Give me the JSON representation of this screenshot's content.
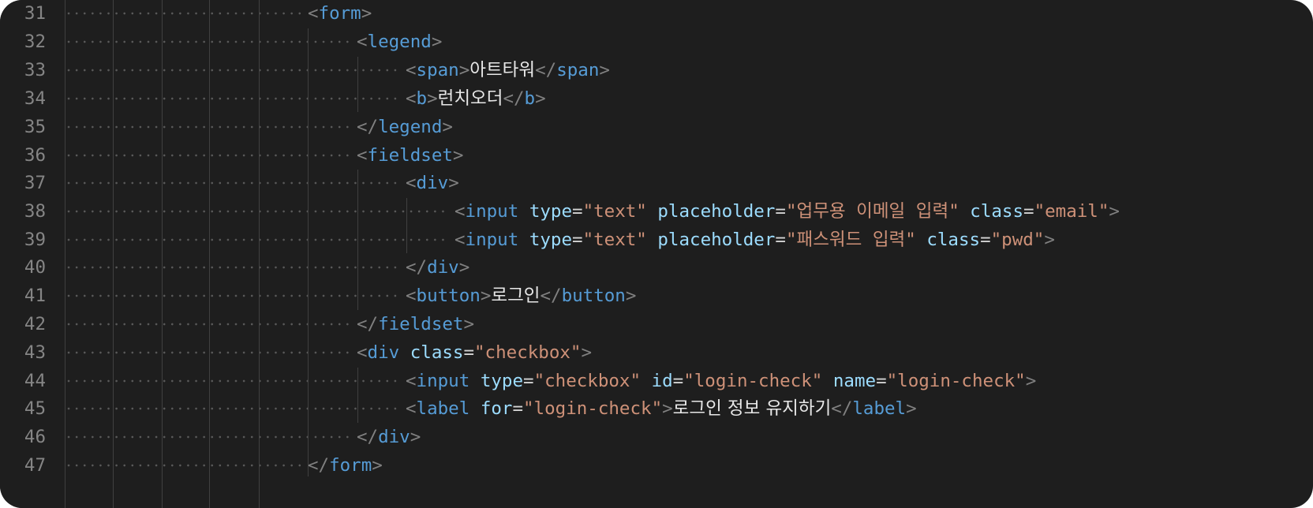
{
  "editor": {
    "line_numbers": [
      "31",
      "32",
      "33",
      "34",
      "35",
      "36",
      "37",
      "38",
      "39",
      "40",
      "41",
      "42",
      "43",
      "44",
      "45",
      "46",
      "47"
    ],
    "code": {
      "l31": {
        "open": "<",
        "tag": "form",
        "close": ">"
      },
      "l32": {
        "open": "<",
        "tag": "legend",
        "close": ">"
      },
      "l33": {
        "open": "<",
        "tag": "span",
        "close": ">",
        "text": "아트타워",
        "end_open": "</",
        "end_tag": "span",
        "end_close": ">"
      },
      "l34": {
        "open": "<",
        "tag": "b",
        "close": ">",
        "text": "런치오더",
        "end_open": "</",
        "end_tag": "b",
        "end_close": ">"
      },
      "l35": {
        "open": "</",
        "tag": "legend",
        "close": ">"
      },
      "l36": {
        "open": "<",
        "tag": "fieldset",
        "close": ">"
      },
      "l37": {
        "open": "<",
        "tag": "div",
        "close": ">"
      },
      "l38": {
        "open": "<",
        "tag": "input",
        "attr1": "type",
        "val1": "\"text\"",
        "attr2": "placeholder",
        "val2": "\"업무용 이메일 입력\"",
        "attr3": "class",
        "val3": "\"email\"",
        "close": ">"
      },
      "l39": {
        "open": "<",
        "tag": "input",
        "attr1": "type",
        "val1": "\"text\"",
        "attr2": "placeholder",
        "val2": "\"패스워드 입력\"",
        "attr3": "class",
        "val3": "\"pwd\"",
        "close": ">"
      },
      "l40": {
        "open": "</",
        "tag": "div",
        "close": ">"
      },
      "l41": {
        "open": "<",
        "tag": "button",
        "close": ">",
        "text": "로그인",
        "end_open": "</",
        "end_tag": "button",
        "end_close": ">"
      },
      "l42": {
        "open": "</",
        "tag": "fieldset",
        "close": ">"
      },
      "l43": {
        "open": "<",
        "tag": "div",
        "attr1": "class",
        "val1": "\"checkbox\"",
        "close": ">"
      },
      "l44": {
        "open": "<",
        "tag": "input",
        "attr1": "type",
        "val1": "\"checkbox\"",
        "attr2": "id",
        "val2": "\"login-check\"",
        "attr3": "name",
        "val3": "\"login-check\"",
        "close": ">"
      },
      "l45": {
        "open": "<",
        "tag": "label",
        "attr1": "for",
        "val1": "\"login-check\"",
        "close": ">",
        "text": "로그인 정보 유지하기",
        "end_open": "</",
        "end_tag": "label",
        "end_close": ">"
      },
      "l46": {
        "open": "</",
        "tag": "div",
        "close": ">"
      },
      "l47": {
        "open": "</",
        "tag": "form",
        "close": ">"
      }
    },
    "eq": "=",
    "colors": {
      "background": "#1e1e1e",
      "tag": "#569cd6",
      "attribute": "#9cdcfe",
      "string": "#ce9178",
      "punctuation": "#808080",
      "text": "#e8e8e8",
      "line_number": "#858585"
    }
  }
}
